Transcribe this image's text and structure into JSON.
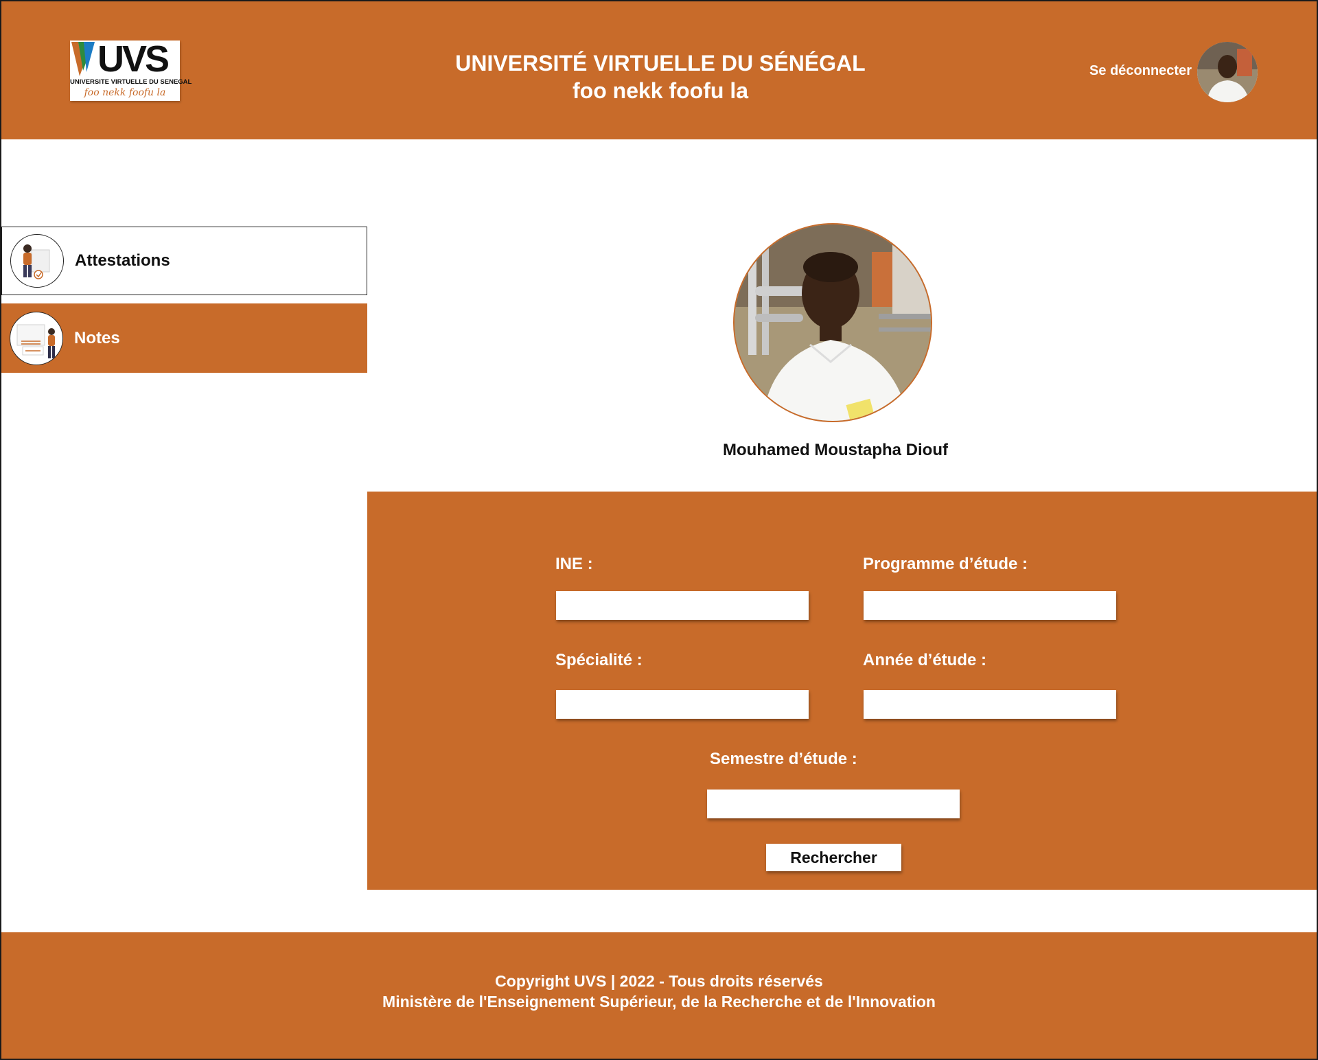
{
  "header": {
    "logo": {
      "letters": "UVS",
      "subtitle": "UNIVERSITE VIRTUELLE DU SENEGAL",
      "motto": "foo nekk foofu la"
    },
    "title_line1": "UNIVERSITÉ VIRTUELLE DU SÉNÉGAL",
    "title_line2": "foo nekk foofu la",
    "logout_label": "Se déconnecter",
    "avatar_icon": "user-photo"
  },
  "sidebar": {
    "items": [
      {
        "label": "Attestations",
        "icon": "attestation-illustration-icon",
        "active": false
      },
      {
        "label": "Notes",
        "icon": "notes-illustration-icon",
        "active": true
      }
    ]
  },
  "profile": {
    "name": "Mouhamed Moustapha Diouf"
  },
  "form": {
    "ine_label": "INE :",
    "ine_value": "",
    "programme_label": "Programme d’étude :",
    "programme_value": "",
    "specialite_label": "Spécialité :",
    "specialite_value": "",
    "annee_label": "Année d’étude :",
    "annee_value": "",
    "semestre_label": "Semestre d’étude :",
    "semestre_value": "",
    "submit_label": "Rechercher"
  },
  "footer": {
    "line1": "Copyright UVS | 2022 - Tous droits réservés",
    "line2": "Ministère de l'Enseignement Supérieur, de la Recherche et de l'Innovation"
  },
  "colors": {
    "brand": "#c86b2a",
    "background": "#ffffff",
    "text": "#111111"
  }
}
